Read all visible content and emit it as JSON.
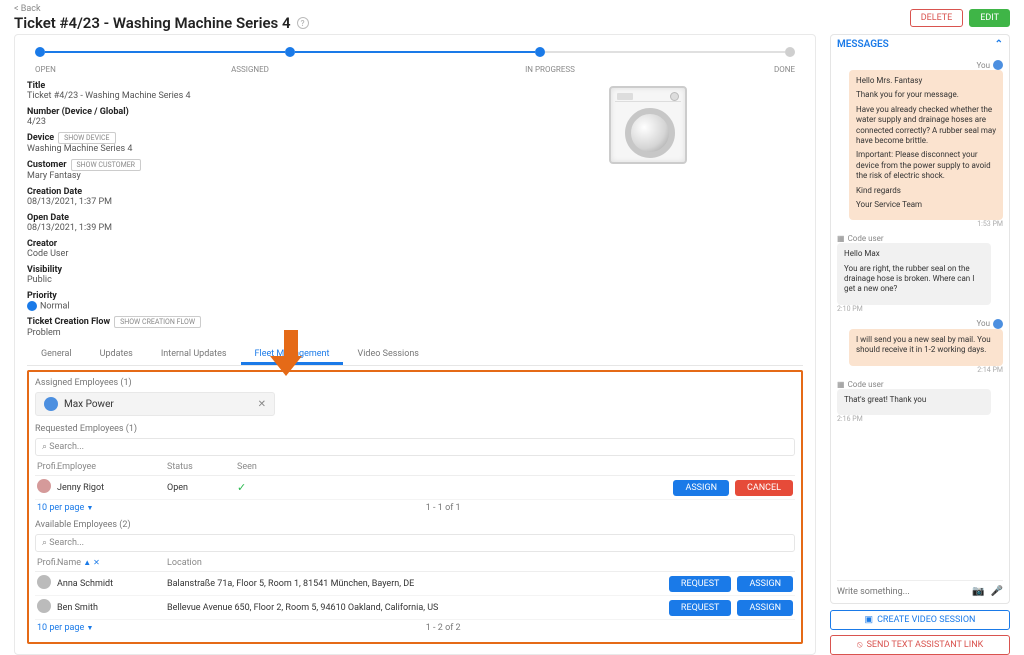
{
  "header": {
    "back": "< Back",
    "title": "Ticket #4/23 - Washing Machine Series 4",
    "delete": "DELETE",
    "edit": "EDIT"
  },
  "stages": [
    "OPEN",
    "ASSIGNED",
    "IN PROGRESS",
    "DONE"
  ],
  "details": {
    "title_lbl": "Title",
    "title_val": "Ticket #4/23 - Washing Machine Series 4",
    "number_lbl": "Number (Device / Global)",
    "number_val": "4/23",
    "device_lbl": "Device",
    "device_btn": "SHOW DEVICE",
    "device_val": "Washing Machine Series 4",
    "customer_lbl": "Customer",
    "customer_btn": "SHOW CUSTOMER",
    "customer_val": "Mary Fantasy",
    "creation_lbl": "Creation Date",
    "creation_val": "08/13/2021, 1:37 PM",
    "open_lbl": "Open Date",
    "open_val": "08/13/2021, 1:39 PM",
    "creator_lbl": "Creator",
    "creator_val": "Code User",
    "visibility_lbl": "Visibility",
    "visibility_val": "Public",
    "priority_lbl": "Priority",
    "priority_val": "Normal",
    "flow_lbl": "Ticket Creation Flow",
    "flow_btn": "SHOW CREATION FLOW",
    "flow_val": "Problem"
  },
  "tabs": {
    "general": "General",
    "updates": "Updates",
    "internal": "Internal Updates",
    "fleet": "Fleet Management",
    "video": "Video Sessions"
  },
  "assigned": {
    "title": "Assigned Employees (1)",
    "name": "Max Power"
  },
  "requested": {
    "title": "Requested Employees (1)",
    "search": "Search...",
    "head_prof": "Profi.",
    "head_emp": "Employee",
    "head_stat": "Status",
    "head_seen": "Seen",
    "row_emp": "Jenny Rigot",
    "row_stat": "Open",
    "assign": "ASSIGN",
    "cancel": "CANCEL",
    "perpage": "10 per page",
    "range": "1 - 1 of 1"
  },
  "available": {
    "title": "Available Employees (2)",
    "search": "Search...",
    "head_prof": "Profi.",
    "head_name": "Name",
    "head_loc": "Location",
    "rows": [
      {
        "name": "Anna Schmidt",
        "loc": "Balanstraße 71a, Floor 5, Room 1, 81541 München, Bayern, DE"
      },
      {
        "name": "Ben Smith",
        "loc": "Bellevue Avenue 650, Floor 2, Room 5, 94610 Oakland, California, US"
      }
    ],
    "request": "REQUEST",
    "assign": "ASSIGN",
    "perpage": "10 per page",
    "range": "1 - 2 of 2"
  },
  "messages": {
    "title": "MESSAGES",
    "you": "You",
    "code_user": "Code user",
    "m1_a": "Hello Mrs. Fantasy",
    "m1_b": "Thank you for your message.",
    "m1_c": "Have you already checked whether the water supply and drainage hoses are connected correctly? A rubber seal may have become brittle.",
    "m1_d": "Important: Please disconnect your device from the power supply to avoid the risk of electric shock.",
    "m1_e": "Kind regards",
    "m1_f": "Your Service Team",
    "m1_time": "1:53 PM",
    "m2_a": "Hello Max",
    "m2_b": "You are right, the rubber seal on the drainage hose is broken. Where can I get a new one?",
    "m2_time": "2:10 PM",
    "m3_a": "I will send you a new seal by mail. You should receive it in 1-2 working days.",
    "m3_time": "2:14 PM",
    "m4_a": "That's great! Thank you",
    "m4_time": "2:16 PM",
    "placeholder": "Write something...",
    "btn_video": "CREATE VIDEO SESSION",
    "btn_send": "SEND TEXT ASSISTANT LINK"
  }
}
